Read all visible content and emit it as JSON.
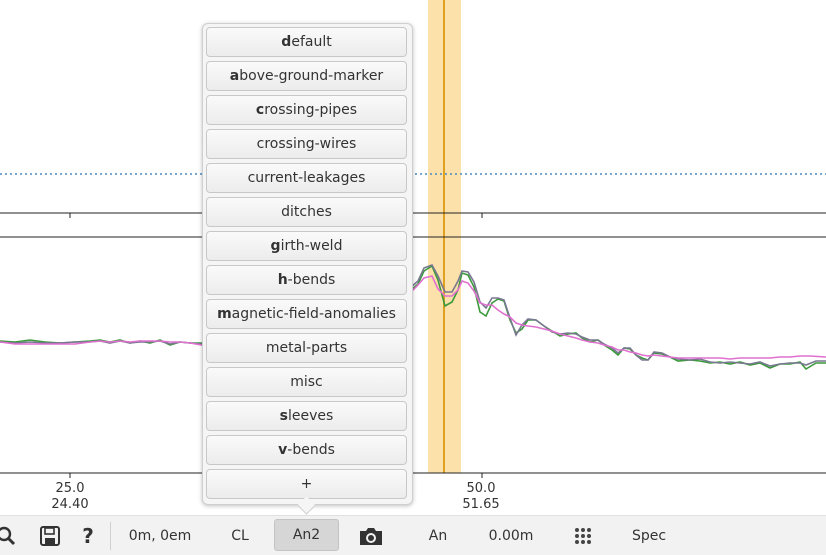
{
  "plot": {
    "x_ticks": [
      {
        "top": "25.0",
        "bottom": "24.40"
      },
      {
        "top": "50.0",
        "bottom": "51.65"
      }
    ],
    "colors": {
      "highlight": "#fde1aa",
      "cursor": "#e0a020",
      "series_green": "#3a9a3a",
      "series_gray": "#787890",
      "series_pink": "#e070d0",
      "dotted": "#4a8ac0"
    }
  },
  "menu": {
    "items": [
      {
        "key": "d",
        "rest": "efault"
      },
      {
        "key": "a",
        "rest": "bove-ground-marker"
      },
      {
        "key": "c",
        "rest": "rossing-pipes"
      },
      {
        "key": "",
        "rest": "crossing-wires"
      },
      {
        "key": "",
        "rest": "current-leakages"
      },
      {
        "key": "",
        "rest": "ditches"
      },
      {
        "key": "g",
        "rest": "irth-weld"
      },
      {
        "key": "h",
        "rest": "-bends"
      },
      {
        "key": "m",
        "rest": "agnetic-field-anomalies"
      },
      {
        "key": "",
        "rest": "metal-parts"
      },
      {
        "key": "",
        "rest": "misc"
      },
      {
        "key": "s",
        "rest": "leeves"
      },
      {
        "key": "v",
        "rest": "-bends"
      },
      {
        "key": "",
        "rest": "+"
      }
    ]
  },
  "toolbar": {
    "search_icon": "search-icon",
    "save_icon": "save-icon",
    "help_label": "?",
    "position": "0m, 0em",
    "cl": "CL",
    "an2": "An2",
    "camera_icon": "camera-icon",
    "an": "An",
    "distance": "0.00m",
    "grid_icon": "grid-icon",
    "spec": "Spec"
  }
}
